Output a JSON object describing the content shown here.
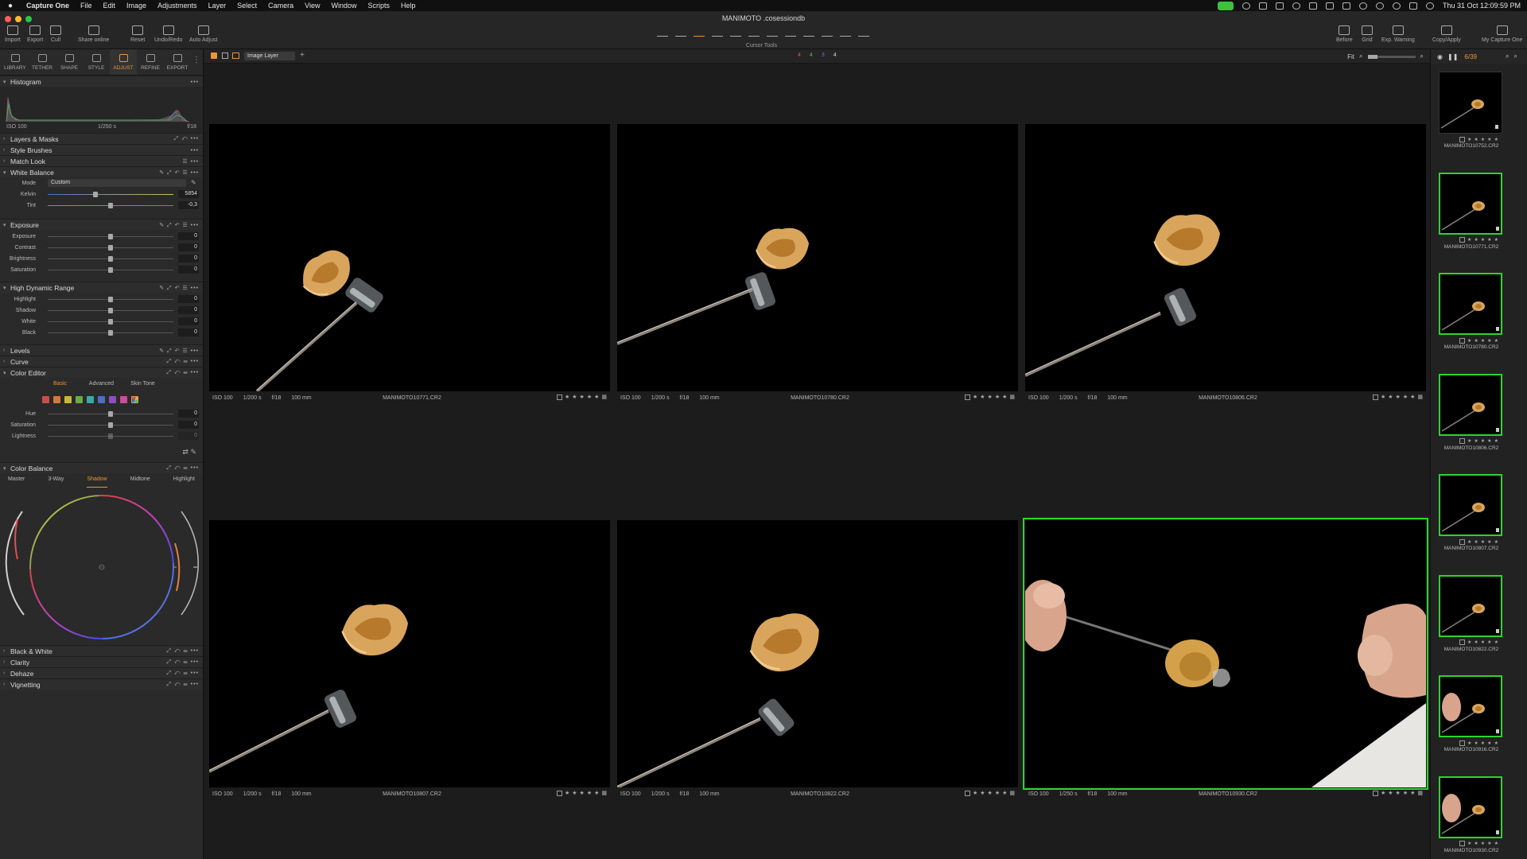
{
  "menubar": {
    "items": [
      "Capture One",
      "File",
      "Edit",
      "Image",
      "Adjustments",
      "Layer",
      "Select",
      "Camera",
      "View",
      "Window",
      "Scripts",
      "Help"
    ],
    "clock": "Thu 31 Oct  12:09:59 PM"
  },
  "window": {
    "title": "MANIMOTO .cosessiondb"
  },
  "toolbar": {
    "left_buttons": [
      "Import",
      "Export",
      "Cull",
      "Share online",
      "Reset",
      "Undo/Redo",
      "Auto Adjust"
    ],
    "cursor_tools_label": "Cursor Tools",
    "right_buttons": [
      "Before",
      "Grid",
      "Exp. Warning",
      "Copy/Apply",
      "My Capture One"
    ]
  },
  "tool_tabs": [
    "LIBRARY",
    "TETHER",
    "SHAPE",
    "STYLE",
    "ADJUST",
    "REFINE",
    "EXPORT"
  ],
  "histogram": {
    "title": "Histogram",
    "iso": "ISO 100",
    "shutter": "1/250 s",
    "aperture": "f/18"
  },
  "sections": {
    "layers": "Layers & Masks",
    "style_brushes": "Style Brushes",
    "match_look": "Match Look",
    "white_balance": "White Balance",
    "exposure": "Exposure",
    "hdr": "High Dynamic Range",
    "levels": "Levels",
    "curve": "Curve",
    "color_editor": "Color Editor",
    "color_balance": "Color Balance",
    "bw": "Black & White",
    "clarity": "Clarity",
    "dehaze": "Dehaze",
    "vignetting": "Vignetting"
  },
  "white_balance": {
    "mode_label": "Mode",
    "mode_value": "Custom",
    "sliders": [
      {
        "label": "Kelvin",
        "value": "5854",
        "pos": 0.38
      },
      {
        "label": "Tint",
        "value": "-0,3",
        "pos": 0.5
      }
    ]
  },
  "exposure_sliders": [
    {
      "label": "Exposure",
      "value": "0",
      "pos": 0.5
    },
    {
      "label": "Contrast",
      "value": "0",
      "pos": 0.5
    },
    {
      "label": "Brightness",
      "value": "0",
      "pos": 0.5
    },
    {
      "label": "Saturation",
      "value": "0",
      "pos": 0.5
    }
  ],
  "hdr_sliders": [
    {
      "label": "Highlight",
      "value": "0",
      "pos": 0.5
    },
    {
      "label": "Shadow",
      "value": "0",
      "pos": 0.5
    },
    {
      "label": "White",
      "value": "0",
      "pos": 0.5
    },
    {
      "label": "Black",
      "value": "0",
      "pos": 0.5
    }
  ],
  "color_editor": {
    "tabs": [
      "Basic",
      "Advanced",
      "Skin Tone"
    ],
    "swatches": [
      "#c9504a",
      "#d27a3c",
      "#c9b53e",
      "#6aab45",
      "#3fa7a1",
      "#4a6fc4",
      "#8a4fc4",
      "#c44f9a"
    ],
    "sliders": [
      {
        "label": "Hue",
        "value": "0",
        "pos": 0.5
      },
      {
        "label": "Saturation",
        "value": "0",
        "pos": 0.5
      },
      {
        "label": "Lightness",
        "value": "0",
        "pos": 0.5
      }
    ]
  },
  "color_balance": {
    "tabs": [
      "Master",
      "3-Way",
      "Shadow",
      "Midtone",
      "Highlight"
    ],
    "active": "Shadow"
  },
  "subbar": {
    "layer": "Image Layer",
    "color_counts": [
      {
        "n": "4",
        "color": "#e05a4a"
      },
      {
        "n": "4",
        "color": "#4fc14f"
      },
      {
        "n": "3",
        "color": "#5a7ce0"
      },
      {
        "n": "4",
        "color": "#d9d9d9"
      }
    ],
    "fit": "Fit"
  },
  "viewer": {
    "images": [
      {
        "iso": "ISO 100",
        "shutter": "1/200 s",
        "aperture": "f/18",
        "focal": "100 mm",
        "name": "MANIMOTO10771.CR2"
      },
      {
        "iso": "ISO 100",
        "shutter": "1/200 s",
        "aperture": "f/18",
        "focal": "100 mm",
        "name": "MANIMOTO10780.CR2"
      },
      {
        "iso": "ISO 100",
        "shutter": "1/200 s",
        "aperture": "f/18",
        "focal": "100 mm",
        "name": "MANIMOTO10806.CR2"
      },
      {
        "iso": "ISO 100",
        "shutter": "1/200 s",
        "aperture": "f/18",
        "focal": "100 mm",
        "name": "MANIMOTO10807.CR2"
      },
      {
        "iso": "ISO 100",
        "shutter": "1/200 s",
        "aperture": "f/18",
        "focal": "100 mm",
        "name": "MANIMOTO10822.CR2"
      },
      {
        "iso": "ISO 100",
        "shutter": "1/250 s",
        "aperture": "f/18",
        "focal": "100 mm",
        "name": "MANIMOTO10930.CR2"
      }
    ]
  },
  "filmstrip": {
    "count": "6/39",
    "items": [
      "MANIMOTO10752.CR2",
      "MANIMOTO10771.CR2",
      "MANIMOTO10780.CR2",
      "MANIMOTO10806.CR2",
      "MANIMOTO10807.CR2",
      "MANIMOTO10822.CR2",
      "MANIMOTO10916.CR2",
      "MANIMOTO10930.CR2"
    ]
  },
  "colors": {
    "accent": "#e9953a",
    "selection": "#2bd52b"
  }
}
